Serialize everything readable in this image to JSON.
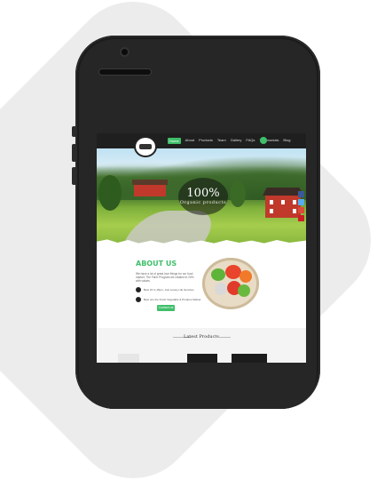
{
  "nav": {
    "items": [
      "Home",
      "About",
      "Products",
      "Team",
      "Gallery",
      "FAQs",
      "Testimonials",
      "Blog"
    ],
    "active_index": 0
  },
  "hero": {
    "title": "100%",
    "subtitle": "Organic products"
  },
  "about": {
    "title": "ABOUT US",
    "text": "We have a lot of great love things for our food market. The Farm Program we created in 20% with values.",
    "items": [
      "Best 15 to 15pm, Just Lovely Life Services",
      "Best one the Fresh Vegetable & Produce Market"
    ],
    "button_label": "Contact us"
  },
  "latest": {
    "title": "Latest Products"
  },
  "colors": {
    "accent": "#3fbf6a",
    "phone": "#1b1b1b"
  },
  "icons": {
    "social": [
      "facebook-icon",
      "twitter-icon",
      "google-plus-icon",
      "pinterest-icon"
    ]
  }
}
